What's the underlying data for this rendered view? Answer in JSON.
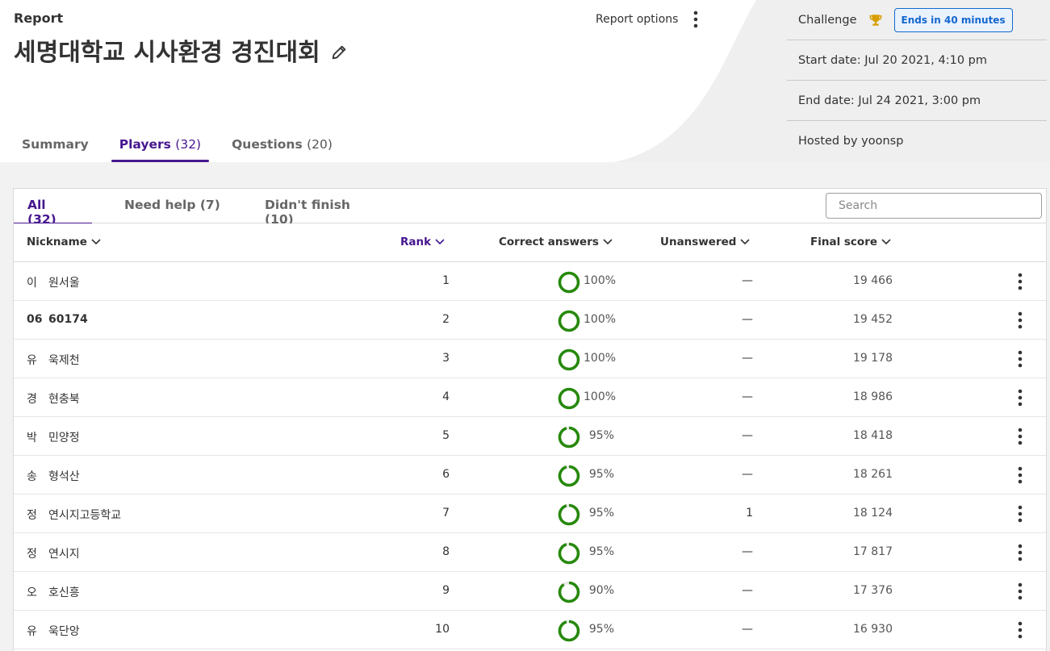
{
  "header": {
    "report_label": "Report",
    "title": "세명대학교 시사환경 경진대회",
    "report_options": "Report options"
  },
  "tabs": [
    {
      "label": "Summary",
      "count": ""
    },
    {
      "label": "Players",
      "count": "(32)"
    },
    {
      "label": "Questions",
      "count": "(20)"
    }
  ],
  "info": {
    "challenge": "Challenge",
    "ends_badge": "Ends in 40 minutes",
    "start_date": "Start date: Jul 20 2021, 4:10 pm",
    "end_date": "End date: Jul 24 2021, 3:00 pm",
    "hosted_by": "Hosted by yoonsp"
  },
  "filters": {
    "all": "All (32)",
    "need_help": "Need help (7)",
    "didnt_finish": "Didn't finish (10)",
    "search_placeholder": "Search"
  },
  "columns": {
    "nickname": "Nickname",
    "rank": "Rank",
    "correct": "Correct answers",
    "unanswered": "Unanswered",
    "final_score": "Final score"
  },
  "rows": [
    {
      "first": "이",
      "last": "원서울",
      "rank": "1",
      "pct": "100%",
      "pct_value": 100,
      "unanswered": "—",
      "score": "19 466"
    },
    {
      "first": "06",
      "last": "60174",
      "rank": "2",
      "pct": "100%",
      "pct_value": 100,
      "unanswered": "—",
      "score": "19 452"
    },
    {
      "first": "유",
      "last": "욱제천",
      "rank": "3",
      "pct": "100%",
      "pct_value": 100,
      "unanswered": "—",
      "score": "19 178"
    },
    {
      "first": "경",
      "last": "현충북",
      "rank": "4",
      "pct": "100%",
      "pct_value": 100,
      "unanswered": "—",
      "score": "18 986"
    },
    {
      "first": "박",
      "last": "민양정",
      "rank": "5",
      "pct": "95%",
      "pct_value": 95,
      "unanswered": "—",
      "score": "18 418"
    },
    {
      "first": "송",
      "last": "형석산",
      "rank": "6",
      "pct": "95%",
      "pct_value": 95,
      "unanswered": "—",
      "score": "18 261"
    },
    {
      "first": "정",
      "last": "연시지고등학교",
      "rank": "7",
      "pct": "95%",
      "pct_value": 95,
      "unanswered": "1",
      "score": "18 124"
    },
    {
      "first": "정",
      "last": "연시지",
      "rank": "8",
      "pct": "95%",
      "pct_value": 95,
      "unanswered": "—",
      "score": "17 817"
    },
    {
      "first": "오",
      "last": "호신흥",
      "rank": "9",
      "pct": "90%",
      "pct_value": 90,
      "unanswered": "—",
      "score": "17 376"
    },
    {
      "first": "유",
      "last": "욱단앙",
      "rank": "10",
      "pct": "95%",
      "pct_value": 95,
      "unanswered": "—",
      "score": "16 930"
    }
  ],
  "colors": {
    "accent": "#46178f",
    "ring_green": "#26890c",
    "ring_track": "#e9e9e9",
    "badge_blue": "#1368ce",
    "trophy": "#d89e00"
  }
}
